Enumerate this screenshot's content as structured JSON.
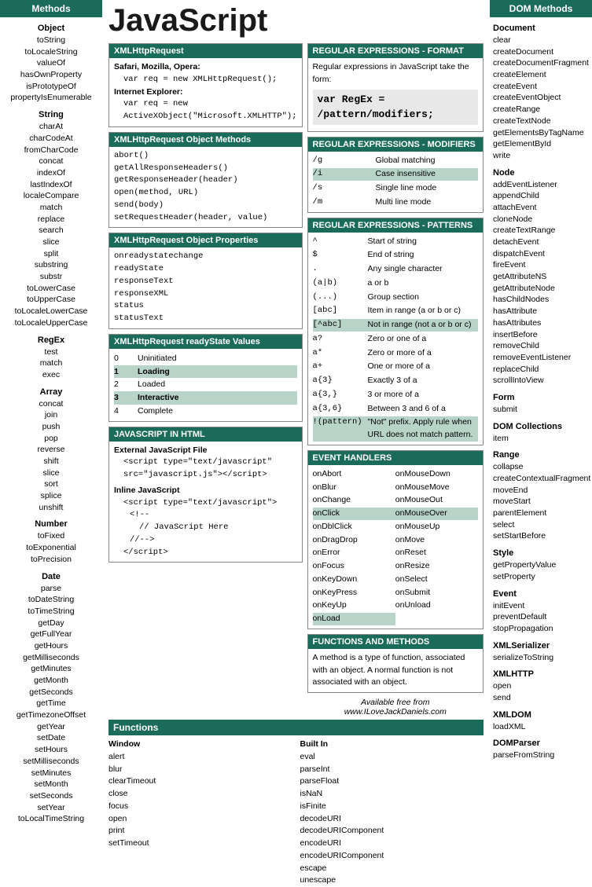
{
  "leftSidebar": {
    "header": "Methods",
    "sections": [
      {
        "title": "Object",
        "items": [
          "toString",
          "toLocaleString",
          "valueOf",
          "hasOwnProperty",
          "isPrototypeOf",
          "propertyIsEnumerable"
        ]
      },
      {
        "title": "String",
        "items": [
          "charAt",
          "charCodeAt",
          "fromCharCode",
          "concat",
          "indexOf",
          "lastIndexOf",
          "localeCompare",
          "match",
          "replace",
          "search",
          "slice",
          "split",
          "substring",
          "substr",
          "toLowerCase",
          "toUpperCase",
          "toLocaleLowerCase",
          "toLocaleUpperCase"
        ]
      },
      {
        "title": "RegEx",
        "items": [
          "test",
          "match",
          "exec"
        ]
      },
      {
        "title": "Array",
        "items": [
          "concat",
          "join",
          "push",
          "pop",
          "reverse",
          "shift",
          "slice",
          "sort",
          "splice",
          "unshift"
        ]
      },
      {
        "title": "Number",
        "items": [
          "toFixed",
          "toExponential",
          "toPrecision"
        ]
      },
      {
        "title": "Date",
        "items": [
          "parse",
          "toDateString",
          "toTimeString",
          "getDay",
          "getFullYear",
          "getHours",
          "getMilliseconds",
          "getMinutes",
          "getMonth",
          "getSeconds",
          "getTime",
          "getTimezoneOffset",
          "getYear",
          "setDate",
          "setHours",
          "setMilliseconds",
          "setMinutes",
          "setMonth",
          "setSeconds",
          "setYear",
          "toLocalTimeString"
        ]
      }
    ]
  },
  "rightSidebar": {
    "header": "DOM Methods",
    "sections": [
      {
        "title": "Document",
        "items": [
          "clear",
          "createDocument",
          "createDocumentFragment",
          "createElement",
          "createEvent",
          "createEventObject",
          "createRange",
          "createTextNode",
          "getElementsByTagName",
          "getElementById",
          "write"
        ]
      },
      {
        "title": "Node",
        "items": [
          "addEventListener",
          "appendChild",
          "attachEvent",
          "cloneNode",
          "createTextRange",
          "detachEvent",
          "dispatchEvent",
          "fireEvent",
          "getAttributeNS",
          "getAttributeNode",
          "hasChildNodes",
          "hasAttribute",
          "hasAttributes",
          "insertBefore",
          "removeChild",
          "removeEventListener",
          "replaceChild",
          "scrollIntoView"
        ]
      },
      {
        "title": "Form",
        "items": [
          "submit"
        ]
      },
      {
        "title": "DOM Collections",
        "items": [
          "item"
        ]
      },
      {
        "title": "Range",
        "items": [
          "collapse",
          "createContextualFragment",
          "moveEnd",
          "moveStart",
          "parentElement",
          "select",
          "setStartBefore"
        ]
      },
      {
        "title": "Style",
        "items": [
          "getPropertyValue",
          "setProperty"
        ]
      },
      {
        "title": "Event",
        "items": [
          "initEvent",
          "preventDefault",
          "stopPropagation"
        ]
      },
      {
        "title": "XMLSerializer",
        "items": [
          "serializeToString"
        ]
      },
      {
        "title": "XMLHTTP",
        "items": [
          "open",
          "send"
        ]
      },
      {
        "title": "XMLDOM",
        "items": [
          "loadXML"
        ]
      },
      {
        "title": "DOMParser",
        "items": [
          "parseFromString"
        ]
      }
    ]
  },
  "pageTitle": "JavaScript",
  "xmlHttpRequest": {
    "header": "XMLHttpRequest",
    "safariLabel": "Safari, Mozilla, Opera:",
    "safariCode": "var req = new XMLHttpRequest();",
    "ieLabel": "Internet Explorer:",
    "ieCode1": "var req = new",
    "ieCode2": "ActiveXObject(\"Microsoft.XMLHTTP\");"
  },
  "xmlHttpRequestMethods": {
    "header": "XMLHttpRequest Object Methods",
    "methods": [
      "abort()",
      "getAllResponseHeaders()",
      "getResponseHeader(header)",
      "open(method, URL)",
      "send(body)",
      "setRequestHeader(header, value)"
    ]
  },
  "xmlHttpRequestProperties": {
    "header": "XMLHttpRequest Object Properties",
    "properties": [
      "onreadystatechange",
      "readyState",
      "responseText",
      "responseXML",
      "status",
      "statusText"
    ]
  },
  "xmlHttpRequestReadyState": {
    "header": "XMLHttpRequest readyState Values",
    "rows": [
      {
        "value": "0",
        "label": "Uninitiated",
        "highlighted": false
      },
      {
        "value": "1",
        "label": "Loading",
        "highlighted": true
      },
      {
        "value": "2",
        "label": "Loaded",
        "highlighted": false
      },
      {
        "value": "3",
        "label": "Interactive",
        "highlighted": true
      },
      {
        "value": "4",
        "label": "Complete",
        "highlighted": false
      }
    ]
  },
  "jsInHtml": {
    "header": "JAVASCRIPT IN HTML",
    "externalLabel": "External JavaScript File",
    "externalCode1": "<script type=\"text/javascript\"",
    "externalCode2": " src=\"javascript.js\"></script>",
    "inlineLabel": "Inline JavaScript",
    "inlineCode": [
      "<script type=\"text/javascript\">",
      "  <!--",
      "    // JavaScript Here",
      "  //-->",
      "</script>"
    ]
  },
  "regexFormat": {
    "header": "REGULAR EXPRESSIONS - FORMAT",
    "description": "Regular expressions in JavaScript take the form:",
    "formula": "var RegEx = /pattern/modifiers;"
  },
  "regexModifiers": {
    "header": "REGULAR EXPRESSIONS - MODIFIERS",
    "rows": [
      {
        "modifier": "/g",
        "description": "Global matching"
      },
      {
        "modifier": "/i",
        "description": "Case insensitive",
        "highlighted": true
      },
      {
        "modifier": "/s",
        "description": "Single line mode"
      },
      {
        "modifier": "/m",
        "description": "Multi line mode"
      }
    ]
  },
  "regexPatterns": {
    "header": "REGULAR EXPRESSIONS - PATTERNS",
    "rows": [
      {
        "pattern": "^",
        "description": "Start of string"
      },
      {
        "pattern": "$",
        "description": "End of string"
      },
      {
        "pattern": ".",
        "description": "Any single character"
      },
      {
        "pattern": "(a|b)",
        "description": "a or b"
      },
      {
        "pattern": "(...)",
        "description": "Group section"
      },
      {
        "pattern": "[abc]",
        "description": "Item in range (a or b or c)"
      },
      {
        "pattern": "[^abc]",
        "description": "Not in range (not a or b or c)",
        "highlighted": true
      },
      {
        "pattern": "a?",
        "description": "Zero or one of a"
      },
      {
        "pattern": "a*",
        "description": "Zero or more of a"
      },
      {
        "pattern": "a+",
        "description": "One or more of a"
      },
      {
        "pattern": "a{3}",
        "description": "Exactly 3 of a"
      },
      {
        "pattern": "a{3,}",
        "description": "3 or more of a"
      },
      {
        "pattern": "a{3,6}",
        "description": "Between 3 and 6 of a"
      },
      {
        "pattern": "!(pattern)",
        "description": "\"Not\" prefix. Apply rule when URL does not match pattern.",
        "highlighted": true
      }
    ]
  },
  "eventHandlers": {
    "header": "EVENT HANDLERS",
    "col1": [
      {
        "name": "onAbort",
        "highlighted": false
      },
      {
        "name": "onBlur",
        "highlighted": false
      },
      {
        "name": "onChange",
        "highlighted": false
      },
      {
        "name": "onClick",
        "highlighted": true
      },
      {
        "name": "onDblClick",
        "highlighted": false
      },
      {
        "name": "onDragDrop",
        "highlighted": false
      },
      {
        "name": "onError",
        "highlighted": false
      },
      {
        "name": "onFocus",
        "highlighted": false
      },
      {
        "name": "onKeyDown",
        "highlighted": false
      },
      {
        "name": "onKeyPress",
        "highlighted": false
      },
      {
        "name": "onKeyUp",
        "highlighted": false
      },
      {
        "name": "onLoad",
        "highlighted": true
      }
    ],
    "col2": [
      {
        "name": "onMouseDown",
        "highlighted": false
      },
      {
        "name": "onMouseMove",
        "highlighted": false
      },
      {
        "name": "onMouseOut",
        "highlighted": false
      },
      {
        "name": "onMouseOver",
        "highlighted": true
      },
      {
        "name": "onMouseUp",
        "highlighted": false
      },
      {
        "name": "onMove",
        "highlighted": false
      },
      {
        "name": "onReset",
        "highlighted": false
      },
      {
        "name": "onResize",
        "highlighted": false
      },
      {
        "name": "onSelect",
        "highlighted": false
      },
      {
        "name": "onSubmit",
        "highlighted": false
      },
      {
        "name": "onUnload",
        "highlighted": false
      }
    ]
  },
  "functionsAndMethods": {
    "header": "FUNCTIONS AND METHODS",
    "description": "A method is a type of function, associated with an object. A normal function is not associated with an object."
  },
  "functions": {
    "header": "Functions",
    "windowTitle": "Window",
    "windowItems": [
      "alert",
      "blur",
      "clearTimeout",
      "close",
      "focus",
      "open",
      "print",
      "setTimeout"
    ],
    "builtInTitle": "Built In",
    "builtInItems": [
      "eval",
      "parseInt",
      "parseFloat",
      "isNaN",
      "isFinite",
      "decodeURI",
      "decodeURIComponent",
      "encodeURI",
      "encodeURIComponent",
      "escape",
      "unescape"
    ]
  },
  "footer": {
    "line1": "Available free from",
    "line2": "www.ILoveJackDaniels.com"
  }
}
